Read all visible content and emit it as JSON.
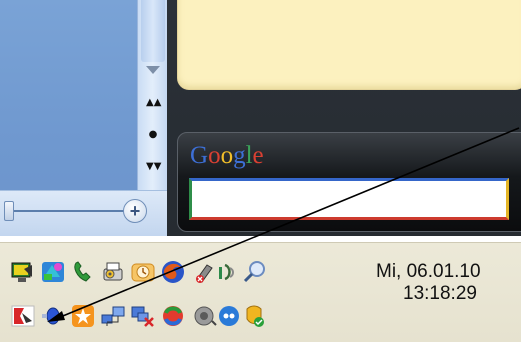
{
  "document": {
    "nav_prev": "▲▲",
    "nav_browse": "●",
    "nav_next": "▼▼",
    "zoom_in_label": "+"
  },
  "google_gadget": {
    "logo_letters": [
      "G",
      "o",
      "o",
      "g",
      "l",
      "e"
    ],
    "search_value": ""
  },
  "tray": {
    "row1_icons": [
      "network-monitor-icon",
      "colorful-app-icon",
      "phone-icon",
      "printer-cog-icon",
      "mail-clock-icon",
      "firefox-icon",
      "disk-tool-icon",
      "wifi-signal-icon",
      "search-magnifier-icon"
    ],
    "row2_icons": [
      "red-flag-icon",
      "satellite-icon",
      "star-icon",
      "network-computers-icon",
      "network-error-icon",
      "sync-icon",
      "volume-icon",
      "messenger-icon",
      "security-shield-icon"
    ],
    "clock_date": "Mi, 06.01.10",
    "clock_time": "13:18:29"
  },
  "colors": {
    "accent_arrow": "#000000",
    "notes_bg": "#fcf1bf",
    "sidebar_bg": "#262b31"
  }
}
